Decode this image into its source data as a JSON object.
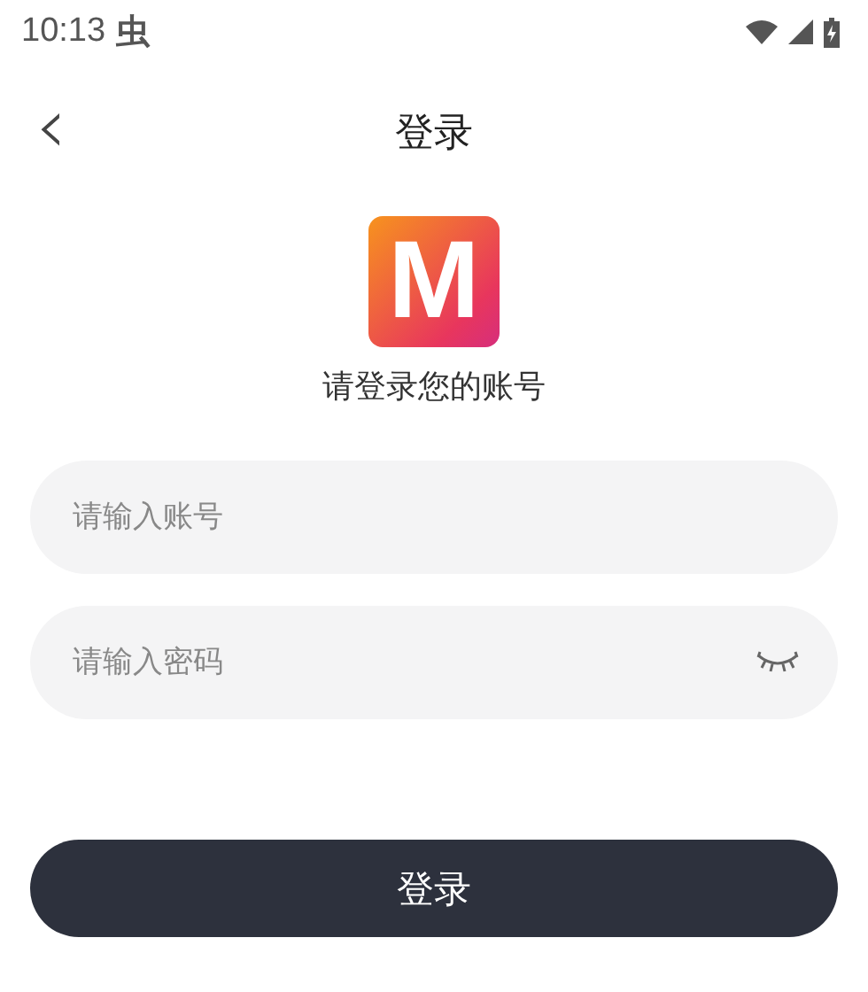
{
  "status_bar": {
    "time": "10:13",
    "notification": "虫"
  },
  "header": {
    "back": "‹",
    "title": "登录"
  },
  "logo": {
    "letter": "M"
  },
  "subtitle": "请登录您的账号",
  "fields": [
    {
      "kind": "text",
      "placeholder": "请输入账号"
    },
    {
      "kind": "password",
      "placeholder": "请输入密码",
      "reveal": false
    }
  ],
  "submit": "登录"
}
